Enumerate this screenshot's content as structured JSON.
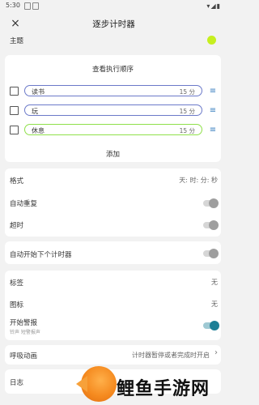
{
  "status_bar": {
    "time": "5:30"
  },
  "app_bar": {
    "close_icon": "×",
    "title": "逐步计时器"
  },
  "theme": {
    "label": "主题",
    "color": "#c6ef1f"
  },
  "sequence": {
    "view_order": "查看执行顺序",
    "tasks": [
      {
        "name": "读书",
        "duration": "15 分",
        "border": "#6b79c9"
      },
      {
        "name": "玩",
        "duration": "15 分",
        "border": "#6b79c9"
      },
      {
        "name": "休息",
        "duration": "15 分",
        "border": "#8fe04a"
      }
    ],
    "add_label": "添加"
  },
  "format": {
    "label": "格式",
    "value": "天: 时: 分: 秒"
  },
  "auto_repeat": {
    "label": "自动重复"
  },
  "timeout": {
    "label": "超时"
  },
  "auto_start_next": {
    "label": "自动开始下个计时器"
  },
  "tag": {
    "label": "标签",
    "value": "无"
  },
  "icon": {
    "label": "图标",
    "value": "无"
  },
  "start_alert": {
    "label": "开始警报",
    "sub": "铃声 短警报声",
    "enabled": true
  },
  "breath_anim": {
    "label": "呼吸动画",
    "value": "计时器暂停或者完成时开启"
  },
  "log": {
    "label": "日志"
  },
  "watermark": {
    "text": "鲤鱼手游网"
  }
}
